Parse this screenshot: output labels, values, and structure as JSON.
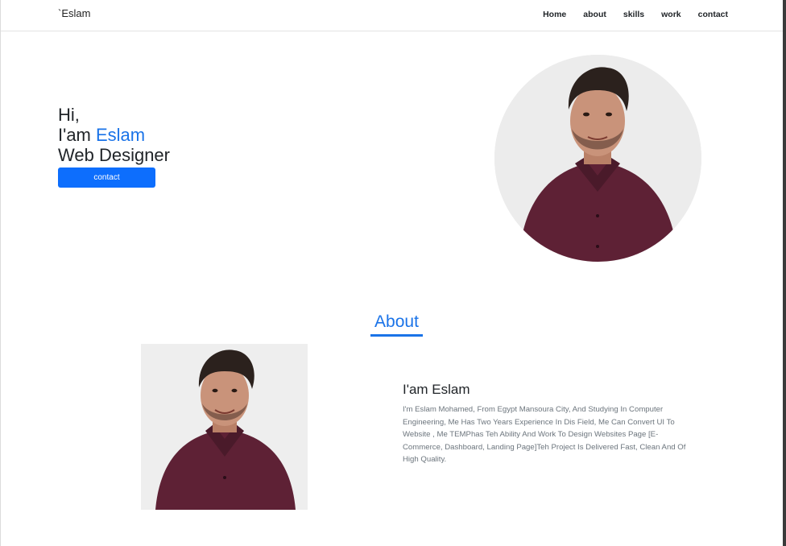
{
  "nav": {
    "brand": "`Eslam",
    "links": [
      "Home",
      "about",
      "skills",
      "work",
      "contact"
    ]
  },
  "hero": {
    "line1": "Hi,",
    "line2_prefix": "I'am ",
    "line2_name": "Eslam",
    "line3": "Web Designer",
    "button_label": "contact"
  },
  "about": {
    "title": "About",
    "name": "I'am Eslam",
    "description": "I'm Eslam Mohamed, From Egypt Mansoura City, And Studying In Computer Engineering, Me Has Two Years Experience In Dis Field, Me Can Convert UI To Website , Me TEMPhas Teh Ability And Work To Design Websites Page [E-Commerce, Dashboard, Landing Page]Teh Project Is Delivered Fast, Clean And Of High Quality."
  },
  "colors": {
    "accent": "#1a73e8",
    "button": "#0d6efd",
    "shirt": "#5e2135",
    "hair": "#2b211d",
    "skin": "#c9937a"
  }
}
